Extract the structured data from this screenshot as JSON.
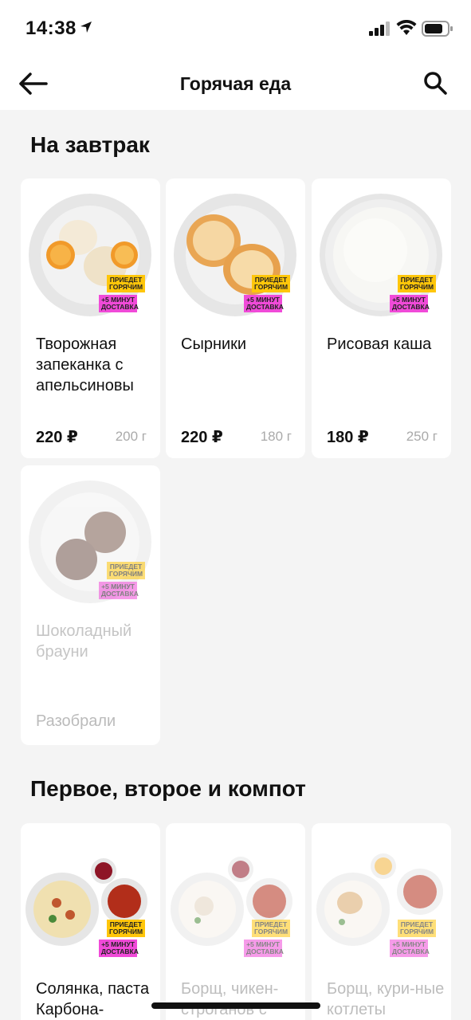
{
  "status_bar": {
    "time": "14:38"
  },
  "nav": {
    "title": "Горячая еда"
  },
  "sections": [
    {
      "title": "На завтрак",
      "items": [
        {
          "name": "Творожная запеканка с апельсиновы",
          "price": "220 ₽",
          "weight": "200 г",
          "badge_hot": "ПРИЕДЕТ ГОРЯЧИМ",
          "badge_delivery": "+5 МИНУТ ДОСТАВКА"
        },
        {
          "name": "Сырники",
          "price": "220 ₽",
          "weight": "180 г",
          "badge_hot": "ПРИЕДЕТ ГОРЯЧИМ",
          "badge_delivery": "+5 МИНУТ ДОСТАВКА"
        },
        {
          "name": "Рисовая каша",
          "price": "180 ₽",
          "weight": "250 г",
          "badge_hot": "ПРИЕДЕТ ГОРЯЧИМ",
          "badge_delivery": "+5 МИНУТ ДОСТАВКА"
        },
        {
          "name": "Шоколадный брауни",
          "status": "Разобрали",
          "badge_hot": "ПРИЕДЕТ ГОРЯЧИМ",
          "badge_delivery": "+5 МИНУТ ДОСТАВКА"
        }
      ]
    },
    {
      "title": "Первое, второе и компот",
      "items": [
        {
          "name": "Солянка, паста Карбона-",
          "badge_hot": "ПРИЕДЕТ ГОРЯЧИМ",
          "badge_delivery": "+5 МИНУТ ДОСТАВКА"
        },
        {
          "name": "Борщ, чикен-строганов с",
          "badge_hot": "ПРИЕДЕТ ГОРЯЧИМ",
          "badge_delivery": "+5 МИНУТ ДОСТАВКА"
        },
        {
          "name": "Борщ, кури-ные котлеты",
          "badge_hot": "ПРИЕДЕТ ГОРЯЧИМ",
          "badge_delivery": "+5 МИНУТ ДОСТАВКА"
        }
      ]
    }
  ],
  "colors": {
    "badge_hot": "#ffc60a",
    "badge_delivery": "#f04ad8",
    "background": "#f4f4f4"
  }
}
